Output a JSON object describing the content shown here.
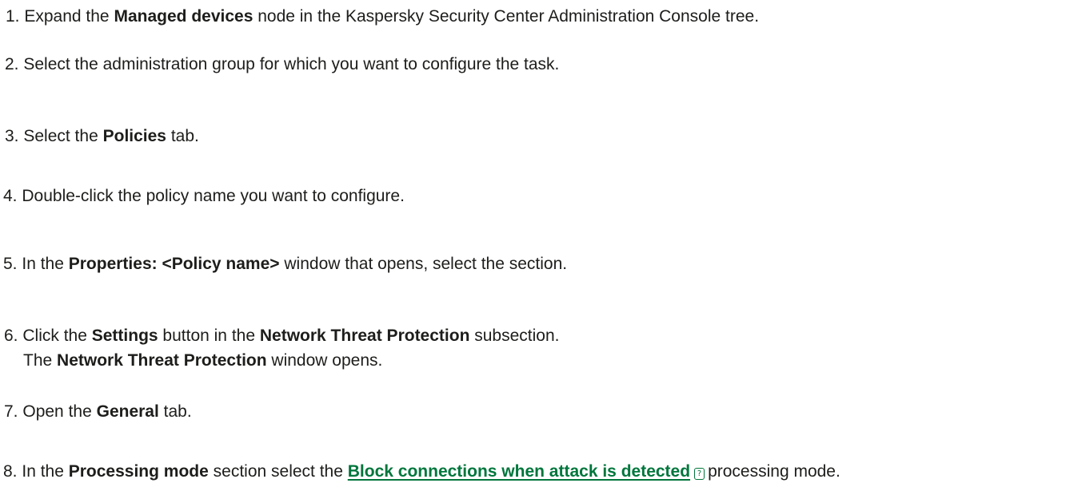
{
  "steps": [
    {
      "number": "1.",
      "pre": "Expand the",
      "bold": "Managed devices",
      "post": "node in the Kaspersky Security Center Administration Console tree."
    },
    {
      "number": "2.",
      "text": "Select the administration group for which you want to configure the task."
    },
    {
      "number": "3.",
      "pre": "Select the",
      "bold": "Policies",
      "post": "tab."
    },
    {
      "number": "4.",
      "text": "Double-click the policy name you want to configure."
    },
    {
      "number": "5.",
      "pre": "In the",
      "bold": "Properties: <Policy name>",
      "post": "window that opens, select the section."
    },
    {
      "number": "6.",
      "pre": "Click the",
      "bold1": "Settings",
      "mid": "button in the",
      "bold2": "Network Threat Protection",
      "post": "subsection.",
      "note_pre": "The",
      "note_bold": "Network Threat Protection",
      "note_post": "window opens."
    },
    {
      "number": "7.",
      "pre": "Open the",
      "bold": "General",
      "post": "tab."
    },
    {
      "number": "8.",
      "pre": "In the",
      "bold": "Processing mode",
      "mid": "section select the",
      "link": "Block connections when attack is detected",
      "help_icon": "?",
      "post": "processing mode."
    }
  ],
  "colors": {
    "text": "#1d1d1b",
    "link": "#00763c"
  },
  "icons": {
    "help": "help-icon"
  }
}
